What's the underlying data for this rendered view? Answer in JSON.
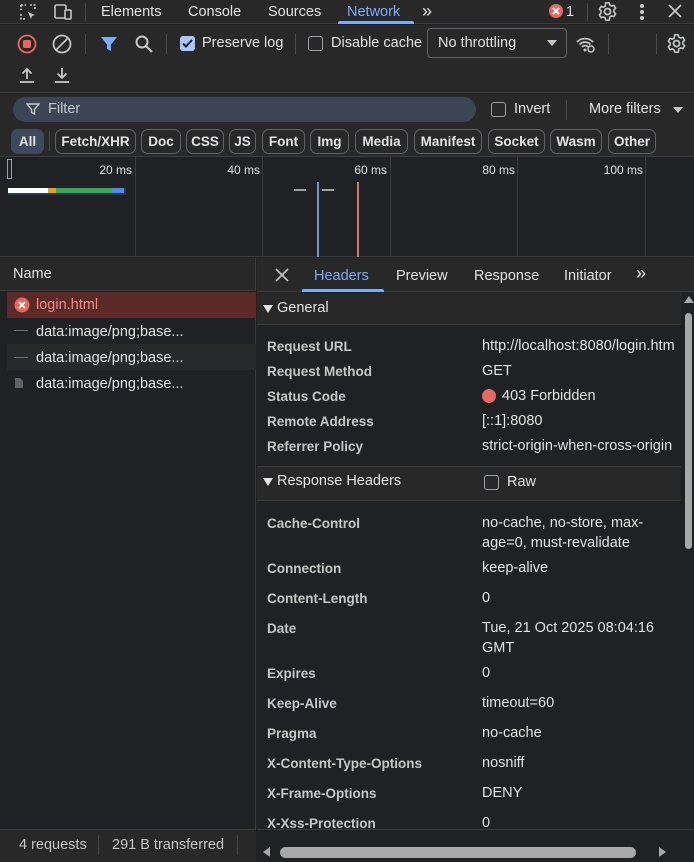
{
  "tabs": {
    "items": [
      "Elements",
      "Console",
      "Sources",
      "Network"
    ],
    "active": "Network",
    "error_count": "1"
  },
  "toolbar": {
    "preserve_log_label": "Preserve log",
    "preserve_log_checked": true,
    "disable_cache_label": "Disable cache",
    "disable_cache_checked": false,
    "throttling_value": "No throttling"
  },
  "filter": {
    "placeholder": "Filter",
    "invert_label": "Invert",
    "more_filters_label": "More filters"
  },
  "type_filters": [
    "All",
    "Fetch/XHR",
    "Doc",
    "CSS",
    "JS",
    "Font",
    "Img",
    "Media",
    "Manifest",
    "Socket",
    "Wasm",
    "Other"
  ],
  "active_type_filter": "All",
  "overview": {
    "ticks": [
      "20 ms",
      "40 ms",
      "60 ms",
      "80 ms",
      "100 ms"
    ]
  },
  "request_list": {
    "header": "Name",
    "rows": [
      {
        "name": "login.html",
        "status": "error"
      },
      {
        "name": "data:image/png;base...",
        "status": "ok"
      },
      {
        "name": "data:image/png;base...",
        "status": "ok"
      },
      {
        "name": "data:image/png;base...",
        "status": "ok"
      }
    ]
  },
  "status_bar": {
    "requests": "4 requests",
    "transferred": "291 B transferred"
  },
  "detail_tabs": {
    "items": [
      "Headers",
      "Preview",
      "Response",
      "Initiator"
    ],
    "active": "Headers"
  },
  "general": {
    "title": "General",
    "rows": [
      {
        "name": "Request URL",
        "value": "http://localhost:8080/login.htm"
      },
      {
        "name": "Request Method",
        "value": "GET"
      },
      {
        "name": "Status Code",
        "value": "403 Forbidden"
      },
      {
        "name": "Remote Address",
        "value": "[::1]:8080"
      },
      {
        "name": "Referrer Policy",
        "value": "strict-origin-when-cross-origin"
      }
    ]
  },
  "response_headers": {
    "title": "Response Headers",
    "raw_label": "Raw",
    "rows": [
      {
        "name": "Cache-Control",
        "value": "no-cache, no-store, max-age=0, must-revalidate"
      },
      {
        "name": "Connection",
        "value": "keep-alive"
      },
      {
        "name": "Content-Length",
        "value": "0"
      },
      {
        "name": "Date",
        "value": "Tue, 21 Oct 2025 08:04:16 GMT"
      },
      {
        "name": "Expires",
        "value": "0"
      },
      {
        "name": "Keep-Alive",
        "value": "timeout=60"
      },
      {
        "name": "Pragma",
        "value": "no-cache"
      },
      {
        "name": "X-Content-Type-Options",
        "value": "nosniff"
      },
      {
        "name": "X-Frame-Options",
        "value": "DENY"
      },
      {
        "name": "X-Xss-Protection",
        "value": "0"
      }
    ]
  },
  "colors": {
    "accent": "#7cacf8",
    "error": "#f28b82",
    "record": "#e46962"
  }
}
